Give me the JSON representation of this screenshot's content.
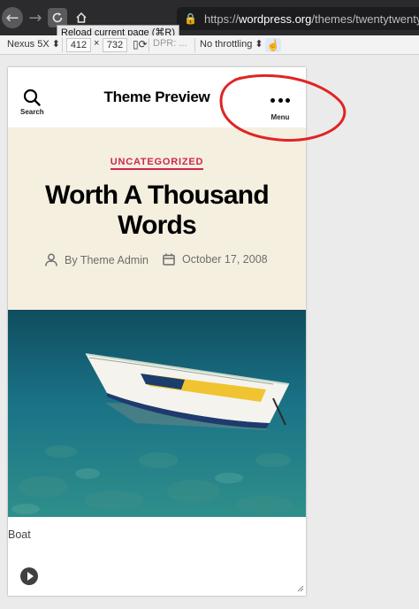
{
  "browser": {
    "url_prefix": "https://",
    "url_domain": "wordpress.org",
    "url_path": "/themes/twentytwenty/",
    "tooltip": "Reload current page (⌘R)"
  },
  "devtools": {
    "device": "Nexus 5X",
    "width": "412",
    "times": "×",
    "height": "732",
    "dpr": "DPR: ...",
    "throttling": "No throttling"
  },
  "site": {
    "search_label": "Search",
    "title": "Theme Preview",
    "menu_label": "Menu"
  },
  "post": {
    "category": "UNCATEGORIZED",
    "title": "Worth A Thousand Words",
    "author": "By Theme Admin",
    "date": "October 17, 2008",
    "caption": "Boat"
  },
  "colors": {
    "accent": "#cd2653",
    "header_bg": "#f5efe0",
    "annotation": "#e02424"
  }
}
